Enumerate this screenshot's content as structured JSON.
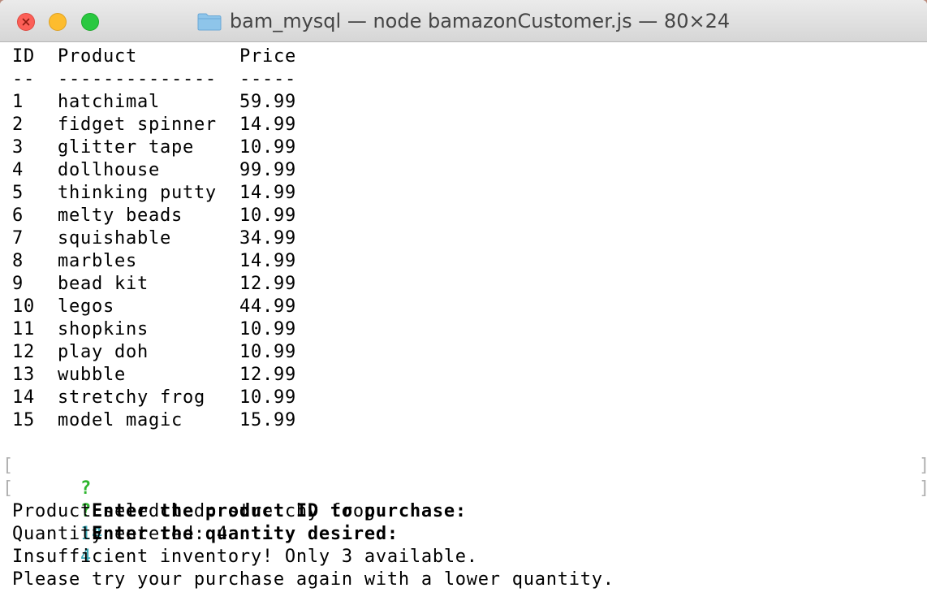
{
  "window": {
    "title": "bam_mysql — node bamazonCustomer.js — 80×24"
  },
  "table": {
    "headers": {
      "id": "ID",
      "product": "Product",
      "price": "Price"
    },
    "separators": {
      "id": "--",
      "product": "--------------",
      "price": "-----"
    },
    "rows": [
      {
        "id": "1",
        "product": "hatchimal",
        "price": "59.99"
      },
      {
        "id": "2",
        "product": "fidget spinner",
        "price": "14.99"
      },
      {
        "id": "3",
        "product": "glitter tape",
        "price": "10.99"
      },
      {
        "id": "4",
        "product": "dollhouse",
        "price": "99.99"
      },
      {
        "id": "5",
        "product": "thinking putty",
        "price": "14.99"
      },
      {
        "id": "6",
        "product": "melty beads",
        "price": "10.99"
      },
      {
        "id": "7",
        "product": "squishable",
        "price": "34.99"
      },
      {
        "id": "8",
        "product": "marbles",
        "price": "14.99"
      },
      {
        "id": "9",
        "product": "bead kit",
        "price": "12.99"
      },
      {
        "id": "10",
        "product": "legos",
        "price": "44.99"
      },
      {
        "id": "11",
        "product": "shopkins",
        "price": "10.99"
      },
      {
        "id": "12",
        "product": "play doh",
        "price": "10.99"
      },
      {
        "id": "13",
        "product": "wubble",
        "price": "12.99"
      },
      {
        "id": "14",
        "product": "stretchy frog",
        "price": "10.99"
      },
      {
        "id": "15",
        "product": "model magic",
        "price": "15.99"
      }
    ]
  },
  "prompts": [
    {
      "mark": "?",
      "question": "Enter the product ID to purchase:",
      "answer": "14"
    },
    {
      "mark": "?",
      "question": "Enter the quantity desired:",
      "answer": "4"
    }
  ],
  "brackets": {
    "open": "[",
    "close": "]"
  },
  "output": [
    "Product seledcted: stretchy frog",
    "Quantity entered: 4",
    "Insufficient inventory! Only 3 available.",
    "Please try your purchase again with a lower quantity."
  ],
  "colors": {
    "titlebar": "#dcdcdc",
    "close": "#fc5f57",
    "minimize": "#fdbc2e",
    "zoom": "#29c840",
    "prompt_mark": "#2db52d",
    "answer": "#3aa9b7",
    "text": "#000000"
  },
  "icons": {
    "titlebar_icon": "folder-icon",
    "close": "close-icon"
  }
}
